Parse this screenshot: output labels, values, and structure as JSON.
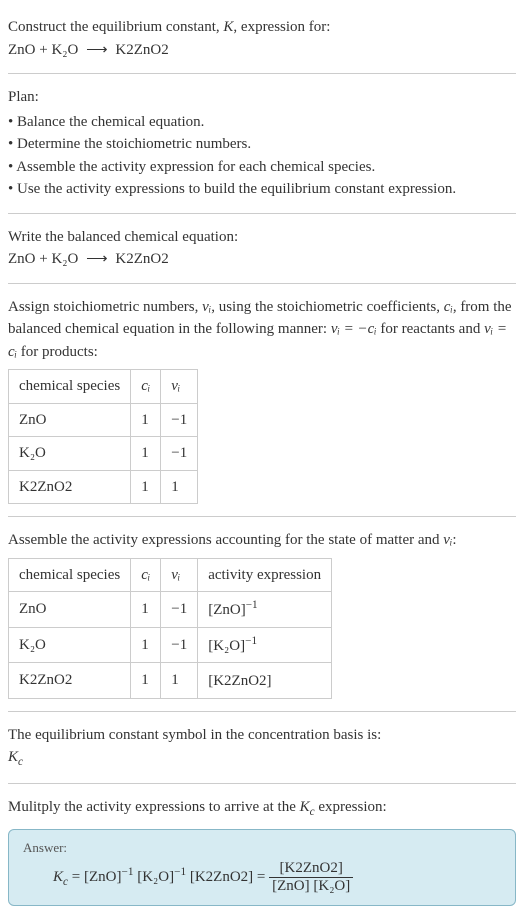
{
  "prompt": {
    "line1_pre": "Construct the equilibrium constant, ",
    "line1_K": "K",
    "line1_post": ", expression for:",
    "equation_lhs": "ZnO + K₂O",
    "equation_arrow": "⟶",
    "equation_rhs": "K2ZnO2"
  },
  "plan_label": "Plan:",
  "plan_items": [
    "Balance the chemical equation.",
    "Determine the stoichiometric numbers.",
    "Assemble the activity expression for each chemical species.",
    "Use the activity expressions to build the equilibrium constant expression."
  ],
  "balanced_label": "Write the balanced chemical equation:",
  "balanced_eq": {
    "lhs": "ZnO + K₂O",
    "arrow": "⟶",
    "rhs": "K2ZnO2"
  },
  "stoich_text_pre": "Assign stoichiometric numbers, ",
  "stoich_sym1": "νᵢ",
  "stoich_text_mid1": ", using the stoichiometric coefficients, ",
  "stoich_sym2": "cᵢ",
  "stoich_text_mid2": ", from the balanced chemical equation in the following manner: ",
  "stoich_rel1": "νᵢ = −cᵢ",
  "stoich_text_mid3": " for reactants and ",
  "stoich_rel2": "νᵢ = cᵢ",
  "stoich_text_post": " for products:",
  "table1": {
    "h1": "chemical species",
    "h2": "cᵢ",
    "h3": "νᵢ",
    "rows": [
      {
        "sp": "ZnO",
        "c": "1",
        "v": "−1"
      },
      {
        "sp": "K₂O",
        "c": "1",
        "v": "−1"
      },
      {
        "sp": "K2ZnO2",
        "c": "1",
        "v": "1"
      }
    ]
  },
  "activity_label_pre": "Assemble the activity expressions accounting for the state of matter and ",
  "activity_label_sym": "νᵢ",
  "activity_label_post": ":",
  "table2": {
    "h1": "chemical species",
    "h2": "cᵢ",
    "h3": "νᵢ",
    "h4": "activity expression",
    "rows": [
      {
        "sp": "ZnO",
        "c": "1",
        "v": "−1",
        "a_base": "[ZnO]",
        "a_exp": "−1"
      },
      {
        "sp": "K₂O",
        "c": "1",
        "v": "−1",
        "a_base": "[K₂O]",
        "a_exp": "−1"
      },
      {
        "sp": "K2ZnO2",
        "c": "1",
        "v": "1",
        "a_base": "[K2ZnO2]",
        "a_exp": ""
      }
    ]
  },
  "symbol_line1": "The equilibrium constant symbol in the concentration basis is:",
  "symbol_Kc": "K",
  "symbol_c": "c",
  "multiply_line_pre": "Mulitply the activity expressions to arrive at the ",
  "multiply_K": "K",
  "multiply_c": "c",
  "multiply_post": " expression:",
  "answer_label": "Answer:",
  "answer": {
    "Kc_K": "K",
    "Kc_c": "c",
    "eq": " = ",
    "t1_base": "[ZnO]",
    "t1_exp": "−1",
    "t2_base": "[K₂O]",
    "t2_exp": "−1",
    "t3": "[K2ZnO2]",
    "eq2": " = ",
    "frac_num": "[K2ZnO2]",
    "frac_den": "[ZnO] [K₂O]"
  },
  "chart_data": {
    "type": "table",
    "tables": [
      {
        "columns": [
          "chemical species",
          "c_i",
          "ν_i"
        ],
        "rows": [
          [
            "ZnO",
            1,
            -1
          ],
          [
            "K2O",
            1,
            -1
          ],
          [
            "K2ZnO2",
            1,
            1
          ]
        ]
      },
      {
        "columns": [
          "chemical species",
          "c_i",
          "ν_i",
          "activity expression"
        ],
        "rows": [
          [
            "ZnO",
            1,
            -1,
            "[ZnO]^-1"
          ],
          [
            "K2O",
            1,
            -1,
            "[K2O]^-1"
          ],
          [
            "K2ZnO2",
            1,
            1,
            "[K2ZnO2]"
          ]
        ]
      }
    ]
  }
}
